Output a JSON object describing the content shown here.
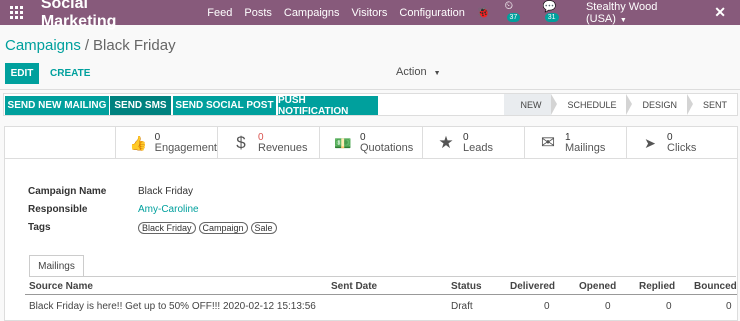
{
  "topbar": {
    "app_name": "Social Marketing",
    "menu": [
      "Feed",
      "Posts",
      "Campaigns",
      "Visitors",
      "Configuration"
    ],
    "activity_count": "37",
    "messages_count": "31",
    "user": "Stealthy Wood (USA)"
  },
  "breadcrumb": {
    "parent": "Campaigns",
    "separator": "/",
    "current": "Black Friday"
  },
  "control": {
    "edit": "EDIT",
    "create": "CREATE",
    "action": "Action"
  },
  "statusbar": {
    "buttons": [
      "SEND NEW MAILING",
      "SEND SMS",
      "SEND SOCIAL POST",
      "PUSH NOTIFICATION"
    ],
    "stages": [
      "NEW",
      "SCHEDULE",
      "DESIGN",
      "SENT"
    ],
    "active_stage": "NEW"
  },
  "stats": [
    {
      "icon": "thumbs-up-icon",
      "glyph": "👍",
      "value": "0",
      "label": "Engagement"
    },
    {
      "icon": "dollar-icon",
      "glyph": "$",
      "value": "0",
      "label": "Revenues"
    },
    {
      "icon": "money-icon",
      "glyph": "💵",
      "value": "0",
      "label": "Quotations"
    },
    {
      "icon": "star-icon",
      "glyph": "★",
      "value": "0",
      "label": "Leads"
    },
    {
      "icon": "envelope-icon",
      "glyph": "✉",
      "value": "1",
      "label": "Mailings"
    },
    {
      "icon": "cursor-icon",
      "glyph": "➤",
      "value": "0",
      "label": "Clicks"
    }
  ],
  "form": {
    "campaign_name_label": "Campaign Name",
    "campaign_name": "Black Friday",
    "responsible_label": "Responsible",
    "responsible": "Amy-Caroline",
    "tags_label": "Tags",
    "tags": [
      "Black Friday",
      "Campaign",
      "Sale"
    ]
  },
  "tabs": {
    "mailings": "Mailings"
  },
  "table": {
    "headers": [
      "Source Name",
      "Sent Date",
      "Status",
      "Delivered",
      "Opened",
      "Replied",
      "Bounced"
    ],
    "rows": [
      {
        "source": "Black Friday is here!! Get up to 50% OFF!!! 2020-02-12 15:13:56",
        "sent_date": "",
        "status": "Draft",
        "delivered": "0",
        "opened": "0",
        "replied": "0",
        "bounced": "0"
      }
    ]
  },
  "colors": {
    "topbar": "#875a7b",
    "accent": "#00a09d"
  }
}
